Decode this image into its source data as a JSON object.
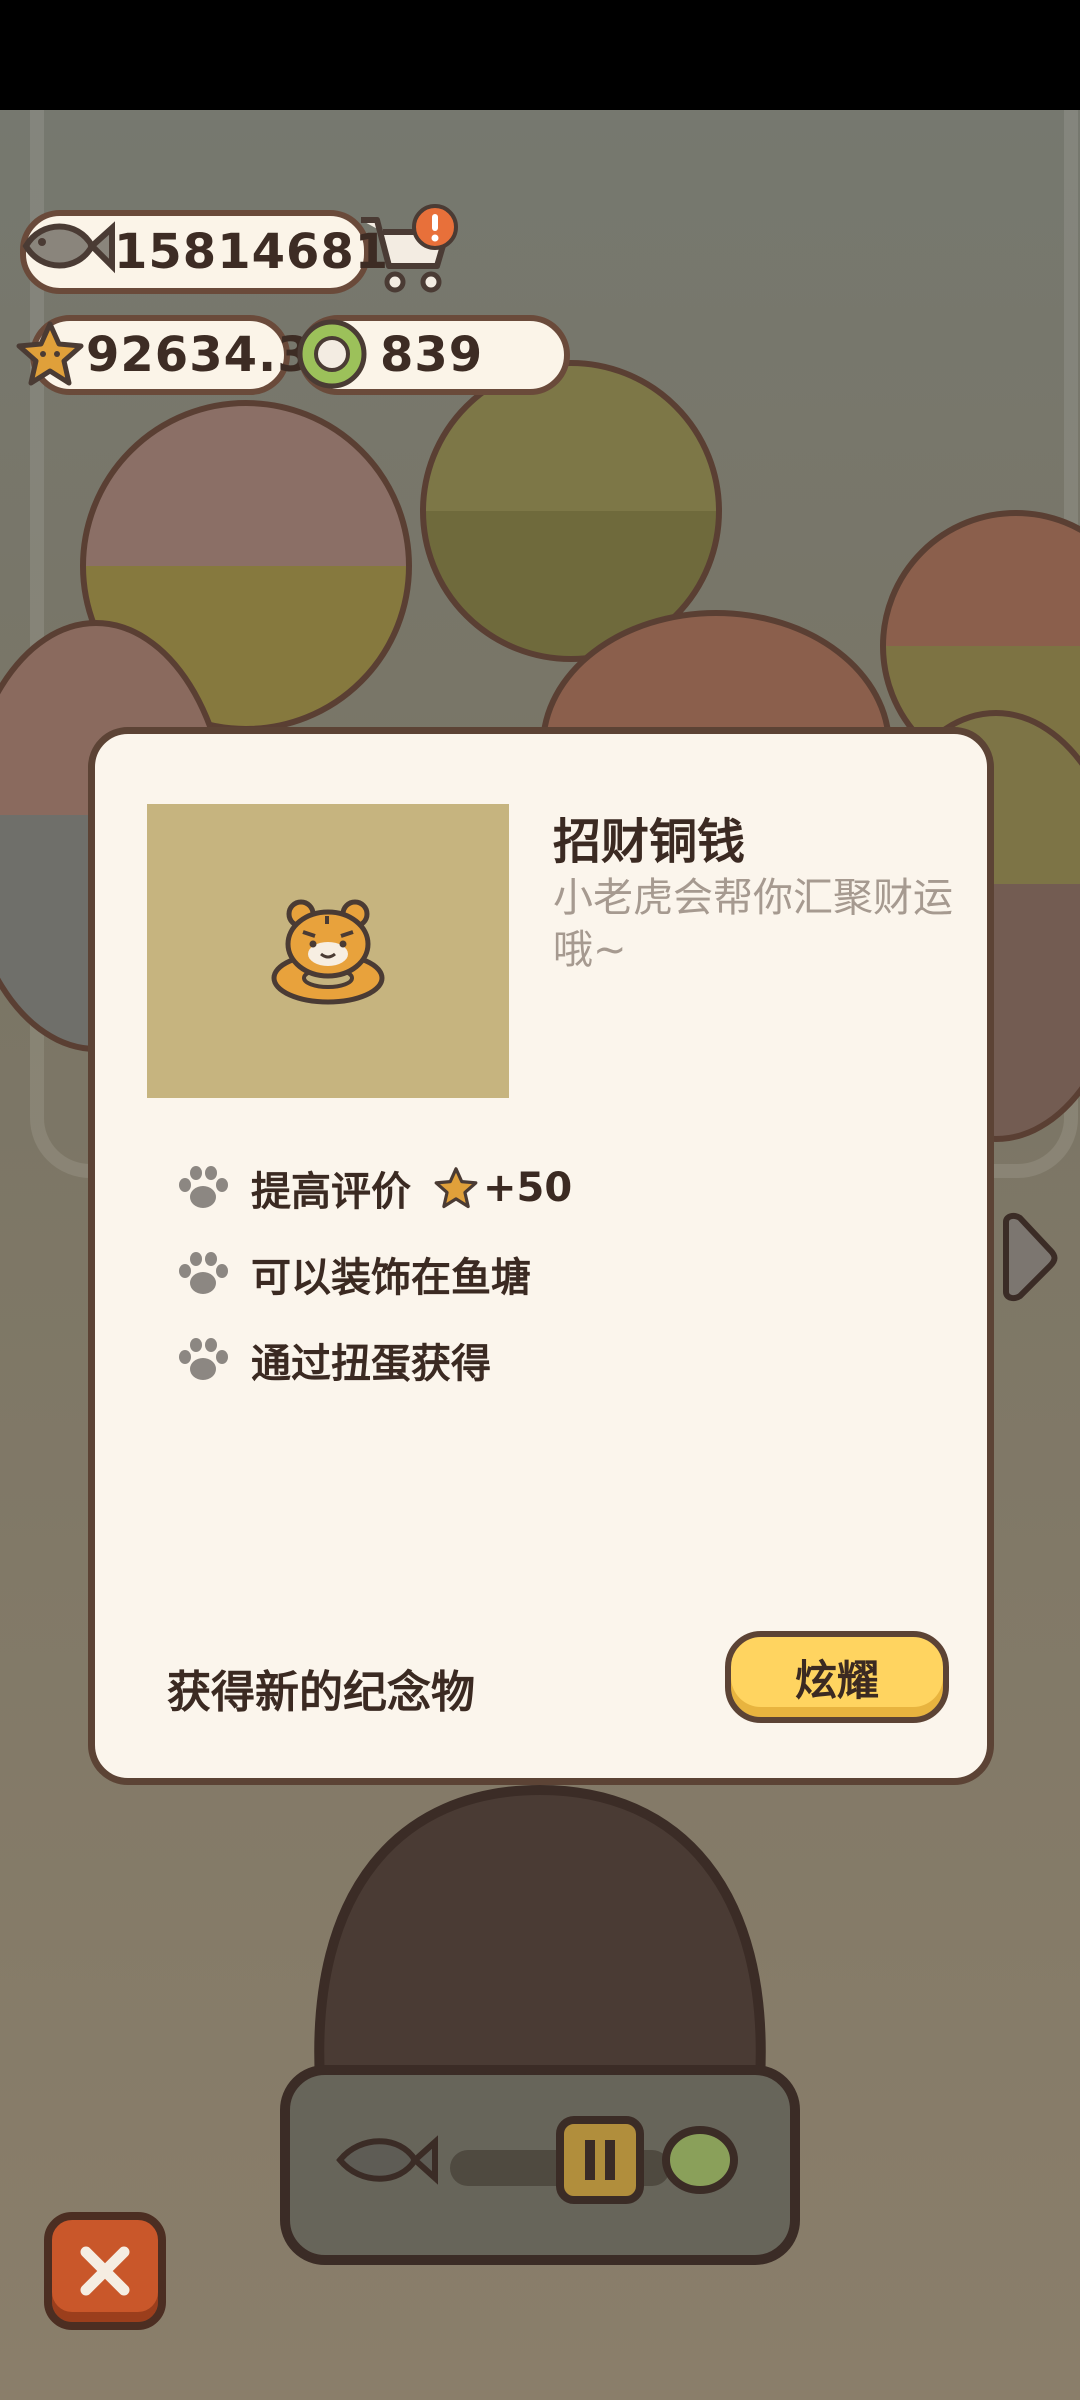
{
  "currency": {
    "fish": "15814681",
    "stars": "92634.3",
    "coins": "839"
  },
  "icons": {
    "fish": "fish-icon",
    "shop": "shopping-cart-icon",
    "alert": "exclamation-badge-icon",
    "star": "star-icon",
    "coin": "coin-icon",
    "paw": "paw-icon",
    "next": "chevron-right-icon",
    "close": "close-icon"
  },
  "item": {
    "name": "招财铜钱",
    "description": "小老虎会帮你汇聚财运哦~",
    "attributes": [
      {
        "label": "提高评价",
        "bonus": "+50"
      },
      {
        "label": "可以装饰在鱼塘"
      },
      {
        "label": "通过扭蛋获得"
      }
    ]
  },
  "modal": {
    "footer_text": "获得新的纪念物",
    "share_button": "炫耀"
  },
  "colors": {
    "accent_yellow": "#ffd460",
    "panel_bg": "#fbf5ec",
    "outline_brown": "#5c4335",
    "close_red": "#c9572a"
  }
}
